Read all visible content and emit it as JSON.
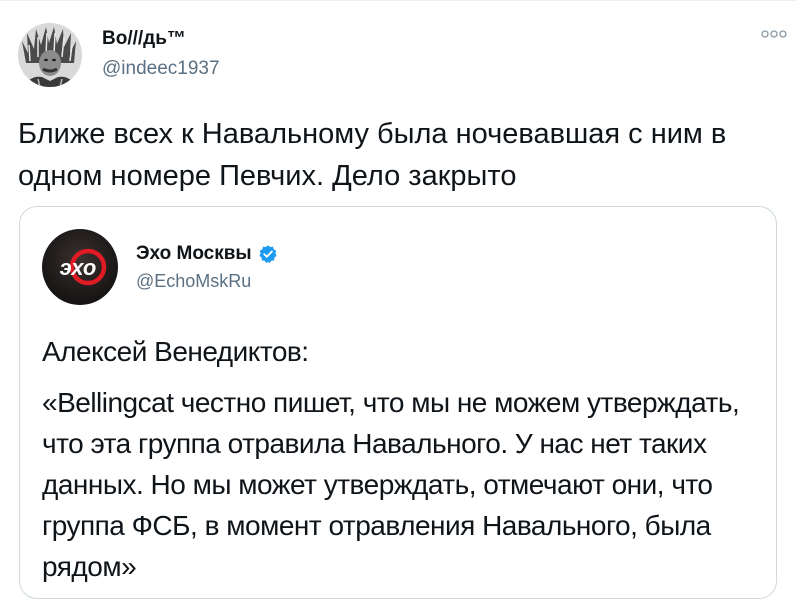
{
  "tweet": {
    "author": {
      "display_name": "Во///дь™",
      "handle": "@indeec1937",
      "avatar_icon": "portrait-avatar-icon"
    },
    "more_icon": "more-horizontal-icon",
    "text": "Ближе всех к Навальному была ночевавшая с ним в одном номере Певчих. Дело закрыто"
  },
  "quoted_tweet": {
    "author": {
      "display_name": "Эхо Москвы",
      "handle": "@EchoMskRu",
      "avatar_text": "эхо",
      "verified_icon": "verified-badge-icon"
    },
    "paragraph_1": "Алексей Венедиктов:",
    "paragraph_2": "«Bellingcat честно пишет, что мы не можем утверждать, что эта группа отравила Навального. У нас нет таких данных. Но мы может утверждать, отмечают они, что группа ФСБ, в момент отравления Навального, была рядом»"
  },
  "colors": {
    "text_primary": "#0f1419",
    "text_secondary": "#5b7083",
    "border": "#cfd9de",
    "verified_blue": "#1d9bf0",
    "echo_red": "#e01b24"
  }
}
